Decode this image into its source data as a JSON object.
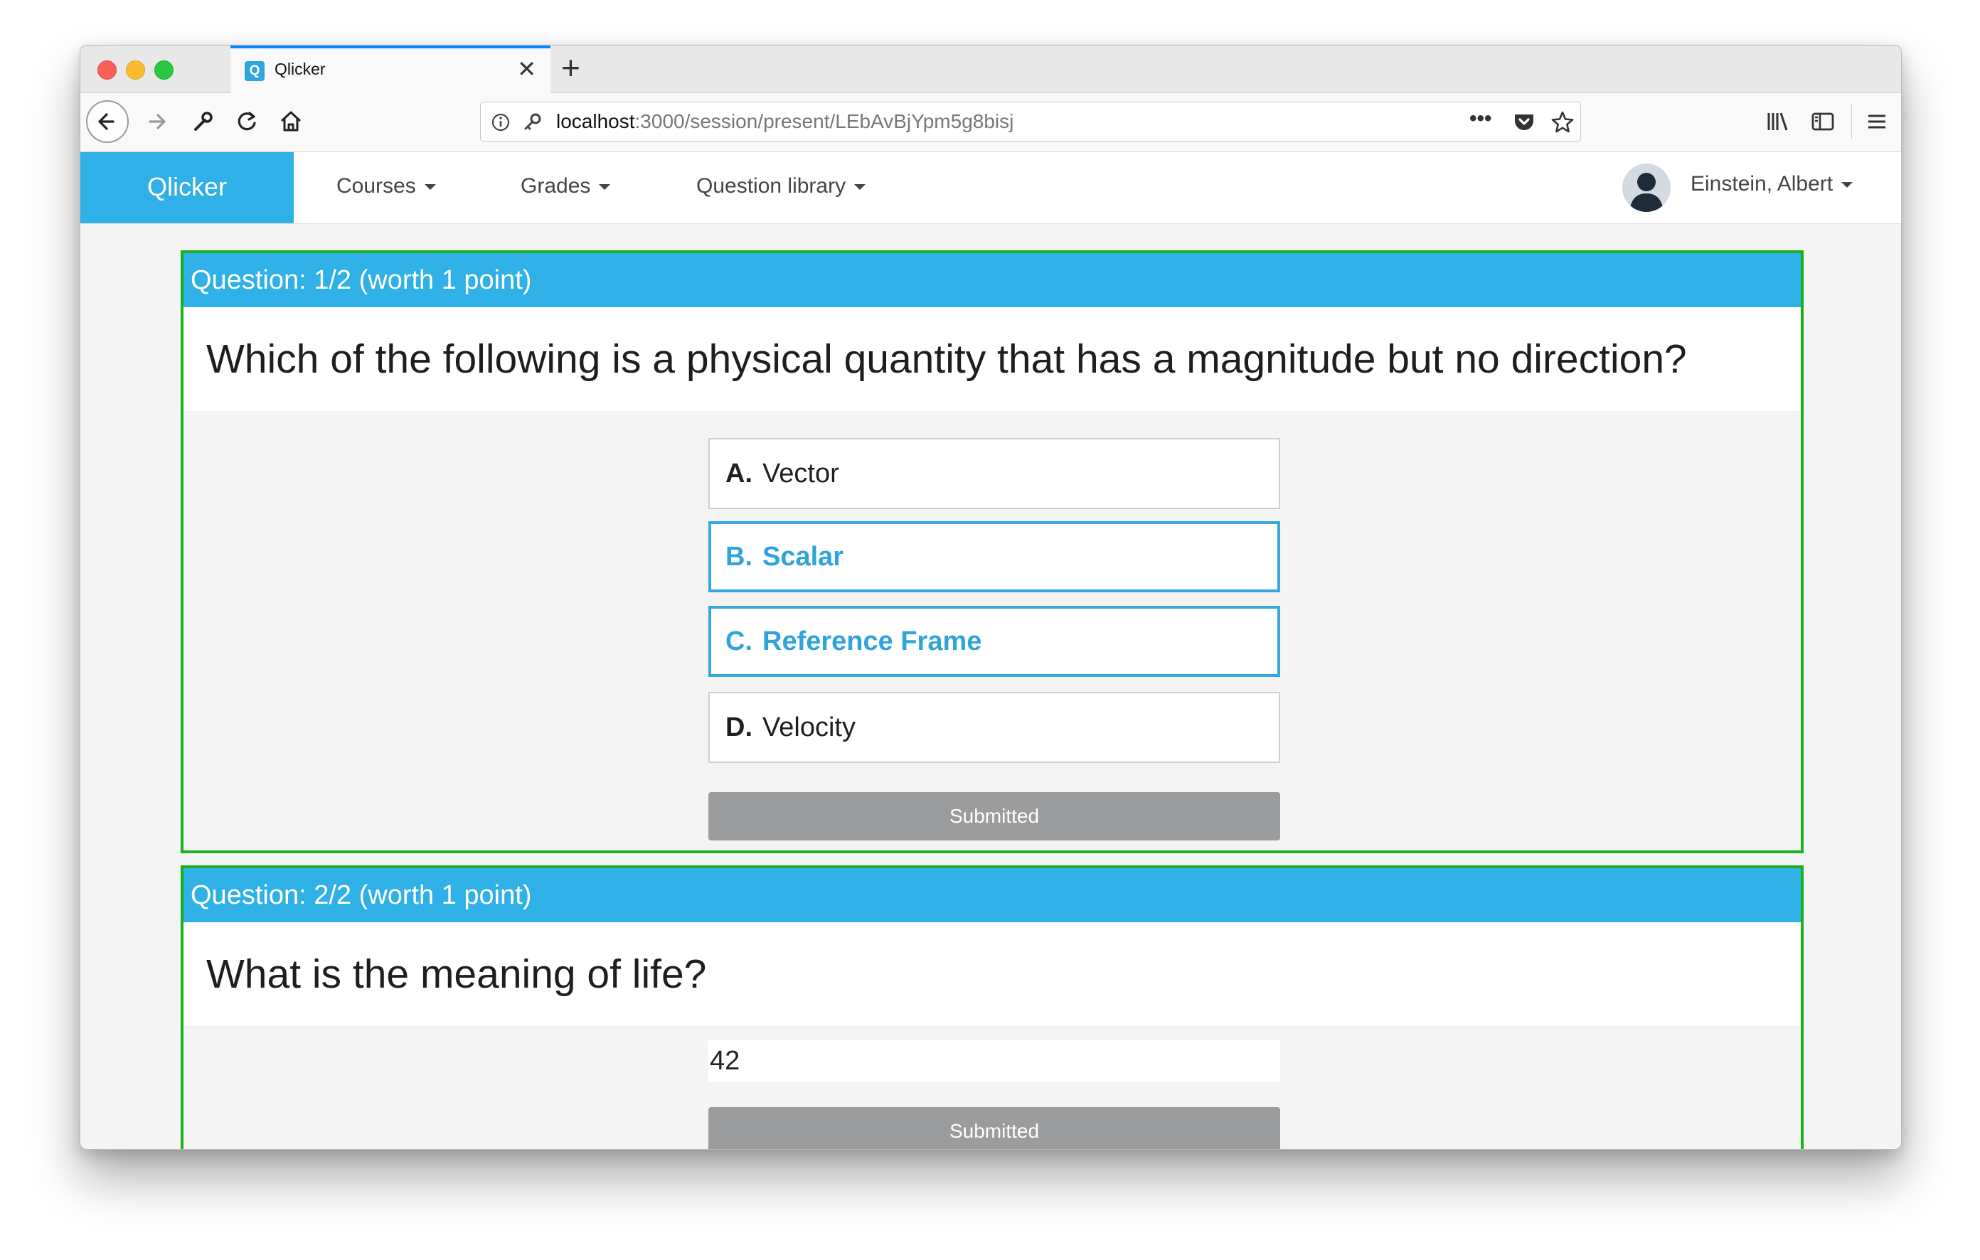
{
  "browser": {
    "tab_title": "Qlicker",
    "tab_favicon": "Q",
    "new_tab": "+",
    "url_host": "localhost",
    "url_path": ":3000/session/present/LEbAvBjYpm5g8bisj",
    "url_more": "•••"
  },
  "navbar": {
    "brand": "Qlicker",
    "items": [
      {
        "label": "Courses"
      },
      {
        "label": "Grades"
      },
      {
        "label": "Question library"
      }
    ],
    "user_name": "Einstein, Albert"
  },
  "questions": [
    {
      "header": "Question: 1/2 (worth 1 point)",
      "text": "Which of the following is a physical quantity that has a magnitude but no direction?",
      "answers": [
        {
          "letter": "A.",
          "text": "Vector",
          "selected": false
        },
        {
          "letter": "B.",
          "text": "Scalar",
          "selected": true
        },
        {
          "letter": "C.",
          "text": "Reference Frame",
          "selected": true
        },
        {
          "letter": "D.",
          "text": "Velocity",
          "selected": false
        }
      ],
      "submit_label": "Submitted"
    },
    {
      "header": "Question: 2/2 (worth 1 point)",
      "text": "What is the meaning of life?",
      "answer_value": "42",
      "submit_label": "Submitted"
    }
  ],
  "colors": {
    "brand": "#2fb0e7",
    "card_border": "#19b11a",
    "selected_answer": "#35a8e0",
    "submitted_button": "#9b9c9e"
  }
}
